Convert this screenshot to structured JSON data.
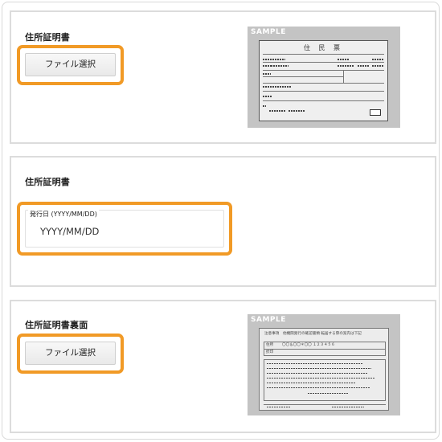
{
  "sections": [
    {
      "title": "住所証明書",
      "file_button_label": "ファイル選択",
      "sample_label": "SAMPLE",
      "sample_doc_title": "住 民 票"
    },
    {
      "title": "住所証明書",
      "date_label": "発行日 (YYYY/MM/DD)",
      "date_placeholder": "YYYY/MM/DD"
    },
    {
      "title": "住所証明書裏面",
      "file_button_label": "ファイル選択",
      "sample_label": "SAMPLE",
      "sample_back": {
        "header": "注意事項　他機関発行の確認書類 転居する際の案内は下記",
        "address_label": "住所",
        "address_value": "〇〇＆〇〇＊〇〇 １２３４５６",
        "seal_label": "捺印"
      }
    }
  ],
  "colors": {
    "highlight": "#f19a26",
    "card_border": "#dcdcdc",
    "sample_bg": "#c4c4c4"
  }
}
